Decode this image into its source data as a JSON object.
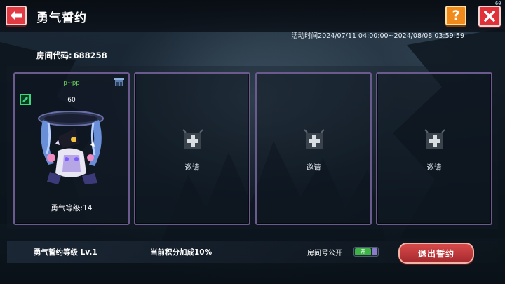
{
  "header": {
    "title": "勇气誓约",
    "help_label": "?",
    "close_badge": "60"
  },
  "activity_time": "活动时间2024/07/11 04:00:00~2024/08/08 03:59:59",
  "room_code": {
    "label": "房间代码:",
    "value": "688258"
  },
  "slots": [
    {
      "type": "player",
      "name": "p~pp",
      "level": "60",
      "courage_level": "勇气等级:14"
    },
    {
      "type": "empty",
      "invite_label": "邀请"
    },
    {
      "type": "empty",
      "invite_label": "邀请"
    },
    {
      "type": "empty",
      "invite_label": "邀请"
    }
  ],
  "footer": {
    "oath_level": "勇气誓约等级 Lv.1",
    "bonus": "当前积分加成10%",
    "public_label": "房间号公开",
    "toggle_state": "开",
    "exit_label": "退出誓约"
  },
  "colors": {
    "panel_border": "#6b5a8e",
    "player_name": "#6fd35a",
    "exit_button": "#c03a3e",
    "back_button": "#e23a42",
    "help_button": "#f08a1a"
  }
}
